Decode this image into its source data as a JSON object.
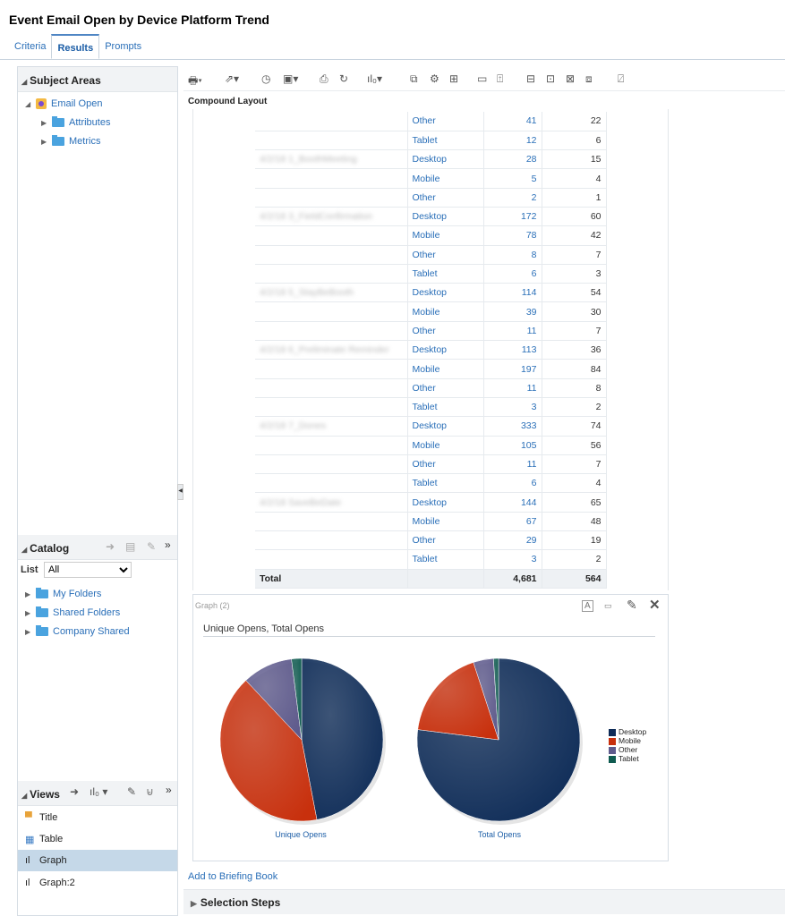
{
  "page": {
    "title": "Event Email Open by Device Platform Trend"
  },
  "tabs": [
    {
      "label": "Criteria"
    },
    {
      "label": "Results"
    },
    {
      "label": "Prompts"
    }
  ],
  "subject_areas": {
    "header": "Subject Areas",
    "root": "Email Open",
    "children": [
      {
        "label": "Attributes"
      },
      {
        "label": "Metrics"
      }
    ]
  },
  "catalog": {
    "header": "Catalog",
    "list_label": "List",
    "list_value": "All",
    "folders": [
      {
        "label": "My Folders"
      },
      {
        "label": "Shared Folders"
      },
      {
        "label": "Company Shared"
      }
    ]
  },
  "views": {
    "header": "Views",
    "items": [
      {
        "label": "Title"
      },
      {
        "label": "Table"
      },
      {
        "label": "Graph"
      },
      {
        "label": "Graph:2"
      }
    ]
  },
  "compound_layout_label": "Compound Layout",
  "table": {
    "rows": [
      {
        "event": "",
        "platform": "Other",
        "unique": "41",
        "total": "22"
      },
      {
        "event": "",
        "platform": "Tablet",
        "unique": "12",
        "total": "6"
      },
      {
        "event": "4/2/18 1_BoothMeeting",
        "platform": "Desktop",
        "unique": "28",
        "total": "15"
      },
      {
        "event": "",
        "platform": "Mobile",
        "unique": "5",
        "total": "4"
      },
      {
        "event": "",
        "platform": "Other",
        "unique": "2",
        "total": "1"
      },
      {
        "event": "4/2/18 3_FieldConfirmation",
        "platform": "Desktop",
        "unique": "172",
        "total": "60"
      },
      {
        "event": "",
        "platform": "Mobile",
        "unique": "78",
        "total": "42"
      },
      {
        "event": "",
        "platform": "Other",
        "unique": "8",
        "total": "7"
      },
      {
        "event": "",
        "platform": "Tablet",
        "unique": "6",
        "total": "3"
      },
      {
        "event": "4/2/18 5_StayBeBooth",
        "platform": "Desktop",
        "unique": "114",
        "total": "54"
      },
      {
        "event": "",
        "platform": "Mobile",
        "unique": "39",
        "total": "30"
      },
      {
        "event": "",
        "platform": "Other",
        "unique": "11",
        "total": "7"
      },
      {
        "event": "4/2/18 6_Preliminate Reminder",
        "platform": "Desktop",
        "unique": "113",
        "total": "36"
      },
      {
        "event": "",
        "platform": "Mobile",
        "unique": "197",
        "total": "84"
      },
      {
        "event": "",
        "platform": "Other",
        "unique": "11",
        "total": "8"
      },
      {
        "event": "",
        "platform": "Tablet",
        "unique": "3",
        "total": "2"
      },
      {
        "event": "4/2/18 7_Dones",
        "platform": "Desktop",
        "unique": "333",
        "total": "74"
      },
      {
        "event": "",
        "platform": "Mobile",
        "unique": "105",
        "total": "56"
      },
      {
        "event": "",
        "platform": "Other",
        "unique": "11",
        "total": "7"
      },
      {
        "event": "",
        "platform": "Tablet",
        "unique": "6",
        "total": "4"
      },
      {
        "event": "4/2/18 SaveBeDate",
        "platform": "Desktop",
        "unique": "144",
        "total": "65"
      },
      {
        "event": "",
        "platform": "Mobile",
        "unique": "67",
        "total": "48"
      },
      {
        "event": "",
        "platform": "Other",
        "unique": "29",
        "total": "19"
      },
      {
        "event": "",
        "platform": "Tablet",
        "unique": "3",
        "total": "2"
      }
    ],
    "total": {
      "label": "Total",
      "unique": "4,681",
      "total": "564"
    }
  },
  "graph": {
    "caption": "Graph (2)",
    "title": "Unique Opens, Total Opens",
    "colors": {
      "Desktop": "#0d2b57",
      "Mobile": "#c8300d",
      "Other": "#5e5a8c",
      "Tablet": "#0f5b50"
    }
  },
  "chart_data": {
    "type": "pie",
    "title": "Unique Opens, Total Opens",
    "legend": [
      "Desktop",
      "Mobile",
      "Other",
      "Tablet"
    ],
    "legend_position": "right",
    "pies": [
      {
        "name": "Unique Opens",
        "values": [
          0.47,
          0.41,
          0.1,
          0.02
        ]
      },
      {
        "name": "Total Opens",
        "values": [
          0.77,
          0.18,
          0.04,
          0.01
        ]
      }
    ]
  },
  "links": {
    "briefing": "Add to Briefing Book"
  },
  "selection_steps": "Selection Steps"
}
